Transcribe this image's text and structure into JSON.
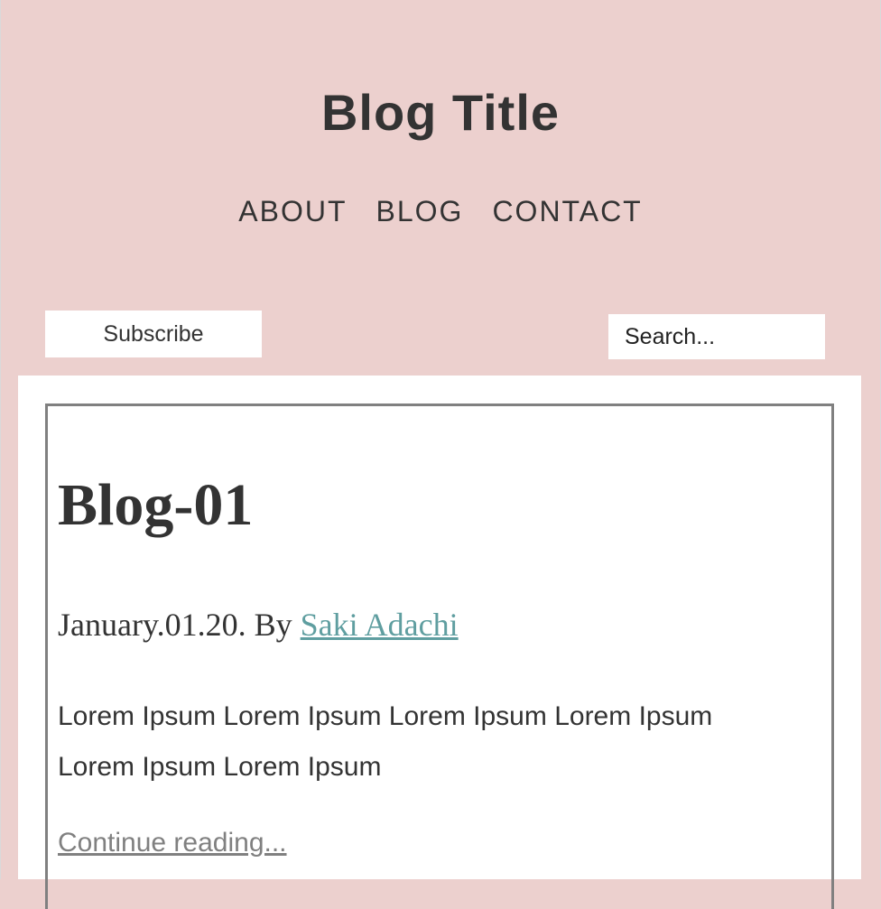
{
  "header": {
    "title": "Blog Title",
    "nav": [
      {
        "label": "ABOUT"
      },
      {
        "label": "BLOG"
      },
      {
        "label": "CONTACT"
      }
    ]
  },
  "toolbar": {
    "subscribe_label": "Subscribe",
    "search_placeholder": "Search..."
  },
  "post": {
    "title": "Blog-01",
    "date_prefix": "January.01.20. By ",
    "author": "Saki Adachi",
    "excerpt": "Lorem Ipsum Lorem Ipsum Lorem Ipsum Lorem Ipsum Lorem Ipsum Lorem Ipsum",
    "continue_label": "Continue reading..."
  },
  "colors": {
    "background": "#ecd0ce",
    "text": "#333333",
    "author_link": "#5f9ea0",
    "continue_link": "#808080",
    "card_border": "#808080"
  }
}
